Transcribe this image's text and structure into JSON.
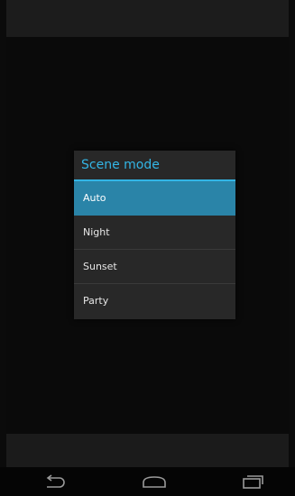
{
  "dialog": {
    "title": "Scene mode",
    "options": [
      {
        "label": "Auto",
        "selected": true
      },
      {
        "label": "Night",
        "selected": false
      },
      {
        "label": "Sunset",
        "selected": false
      },
      {
        "label": "Party",
        "selected": false
      }
    ]
  },
  "nav": {
    "back_icon": "back-arrow-icon",
    "home_icon": "home-icon",
    "recents_icon": "recent-apps-icon"
  },
  "colors": {
    "accent": "#33b5e5",
    "selected_bg": "#2a84a8",
    "dialog_bg": "#282828"
  }
}
